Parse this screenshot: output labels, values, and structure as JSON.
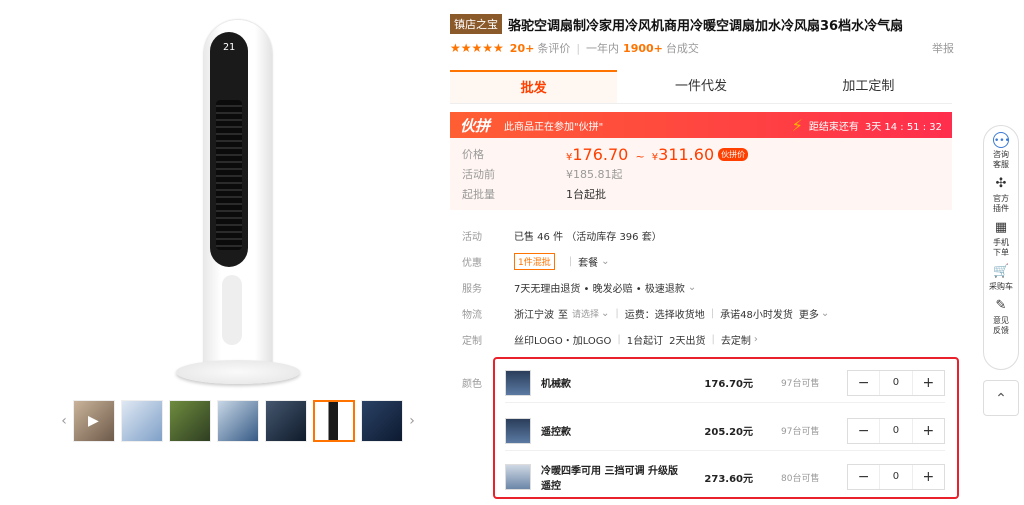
{
  "gallery": {
    "main_display": "21",
    "thumbs": [
      {
        "id": "thumb-video",
        "selected": false
      },
      {
        "id": "thumb-2",
        "selected": false
      },
      {
        "id": "thumb-3",
        "selected": false
      },
      {
        "id": "thumb-4",
        "selected": false
      },
      {
        "id": "thumb-5",
        "selected": false
      },
      {
        "id": "thumb-6",
        "selected": true
      },
      {
        "id": "thumb-7",
        "selected": false
      }
    ]
  },
  "product": {
    "shop_badge": "镇店之宝",
    "title": "骆驼空调扇制冷家用冷风机商用冷暖空调扇加水冷风扇36档水冷气扇",
    "rating_count": "20+",
    "rating_label": "条评价",
    "sales_period": "一年内",
    "sales_count": "1900+",
    "sales_label": "台成交",
    "report": "举报"
  },
  "tabs": [
    "批发",
    "一件代发",
    "加工定制"
  ],
  "promo": {
    "logo": "伙拼",
    "text": "此商品正在参加\"伙拼\"",
    "countdown_label": "距结束还有",
    "countdown": "3天 14 : 51 : 32"
  },
  "price": {
    "price_label": "价格",
    "low": "176.70",
    "high": "311.60",
    "tilde": "~",
    "currency": "¥",
    "tag": "伙拼价",
    "before_label": "活动前",
    "before_value": "¥185.81起",
    "moq_label": "起批量",
    "moq_value": "1台起批"
  },
  "info": {
    "activity_label": "活动",
    "activity_value": "已售 46 件 （活动库存 396 套）",
    "discount_label": "优惠",
    "discount_pill": "1件混批",
    "discount_extra": "套餐",
    "service_label": "服务",
    "service_value": "7天无理由退货 • 晚发必赔 • 极速退款",
    "logistics_label": "物流",
    "logistics_origin": "浙江宁波",
    "logistics_to": "至",
    "logistics_select": "请选择",
    "logistics_fee": "运费：选择收货地",
    "logistics_promise": "承诺48小时发货",
    "logistics_more": "更多",
    "custom_label": "定制",
    "custom_logo": "丝印LOGO・加LOGO",
    "custom_moq": "1台起订",
    "custom_days": "2天出货",
    "custom_link": "去定制"
  },
  "color_label": "颜色",
  "skus": [
    {
      "name": "机械款",
      "price": "176.70元",
      "stock": "97台可售",
      "qty": "0"
    },
    {
      "name": "遥控款",
      "price": "205.20元",
      "stock": "97台可售",
      "qty": "0"
    },
    {
      "name": "冷暖四季可用 三挡可调 升级版遥控",
      "price": "273.60元",
      "stock": "80台可售",
      "qty": "0"
    }
  ],
  "sidebar": [
    {
      "icon": "chat-icon",
      "label": "咨询客服"
    },
    {
      "icon": "plugin-icon",
      "label": "官方插件"
    },
    {
      "icon": "qrcode-icon",
      "label": "手机下单"
    },
    {
      "icon": "cart-icon",
      "label": "采购车"
    },
    {
      "icon": "feedback-icon",
      "label": "意见反馈"
    }
  ],
  "colors": {
    "accent": "#ff7300",
    "price": "#ff4000",
    "promo_start": "#ff5e33",
    "promo_end": "#ff2e4d",
    "highlight_border": "#e8212b"
  }
}
